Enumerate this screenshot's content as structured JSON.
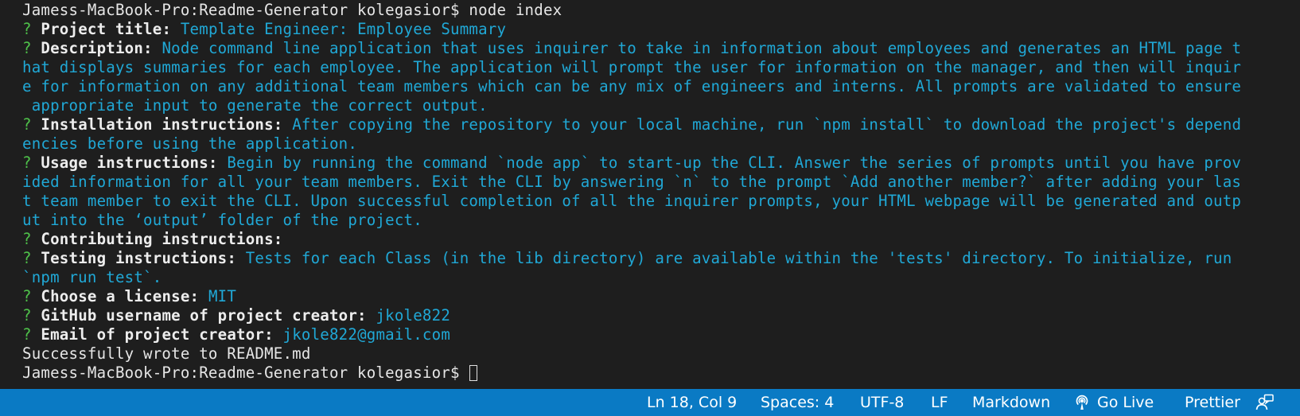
{
  "terminal": {
    "prompt_line_1": "Jamess-MacBook-Pro:Readme-Generator kolegasior$ node index",
    "question_mark": "?",
    "title": {
      "label": "Project title:",
      "value": "Template Engineer: Employee Summary"
    },
    "description": {
      "label": "Description:",
      "lines": [
        "Node command line application that uses inquirer to take in information about employees and generates an HTML page t",
        "hat displays summaries for each employee. The application will prompt the user for information on the manager, and then will inquir",
        "e for information on any additional team members which can be any mix of engineers and interns. All prompts are validated to ensure",
        " appropriate input to generate the correct output."
      ]
    },
    "installation": {
      "label": "Installation instructions:",
      "lines": [
        "After copying the repository to your local machine, run `npm install` to download the project's depend",
        "encies before using the application."
      ]
    },
    "usage": {
      "label": "Usage instructions:",
      "lines": [
        "Begin by running the command `node app` to start-up the CLI. Answer the series of prompts until you have prov",
        "ided information for all your team members. Exit the CLI by answering `n` to the prompt `Add another member?` after adding your las",
        "t team member to exit the CLI. Upon successful completion of all the inquirer prompts, your HTML webpage will be generated and outp",
        "ut into the ‘output’ folder of the project."
      ]
    },
    "contributing": {
      "label": "Contributing instructions:",
      "value": ""
    },
    "testing": {
      "label": "Testing instructions:",
      "lines": [
        "Tests for each Class (in the lib directory) are available within the 'tests' directory. To initialize, run",
        "`npm run test`."
      ]
    },
    "license": {
      "label": "Choose a license:",
      "value": "MIT"
    },
    "github": {
      "label": "GitHub username of project creator:",
      "value": "jkole822"
    },
    "email": {
      "label": "Email of project creator:",
      "value": "jkole822@gmail.com"
    },
    "success_message": "Successfully wrote to README.md",
    "prompt_line_2": "Jamess-MacBook-Pro:Readme-Generator kolegasior$ "
  },
  "statusbar": {
    "cursor_position": "Ln 18, Col 9",
    "indentation": "Spaces: 4",
    "encoding": "UTF-8",
    "line_ending": "LF",
    "language_mode": "Markdown",
    "go_live": "Go Live",
    "prettier": "Prettier"
  },
  "colors": {
    "terminal_bg": "#1e1e1e",
    "question_mark": "#4ec04a",
    "answer_text": "#20a8d6",
    "statusbar_bg": "#0a7ac4"
  },
  "icons": {
    "go_live": "broadcast-icon",
    "feedback": "feedback-person-icon"
  }
}
